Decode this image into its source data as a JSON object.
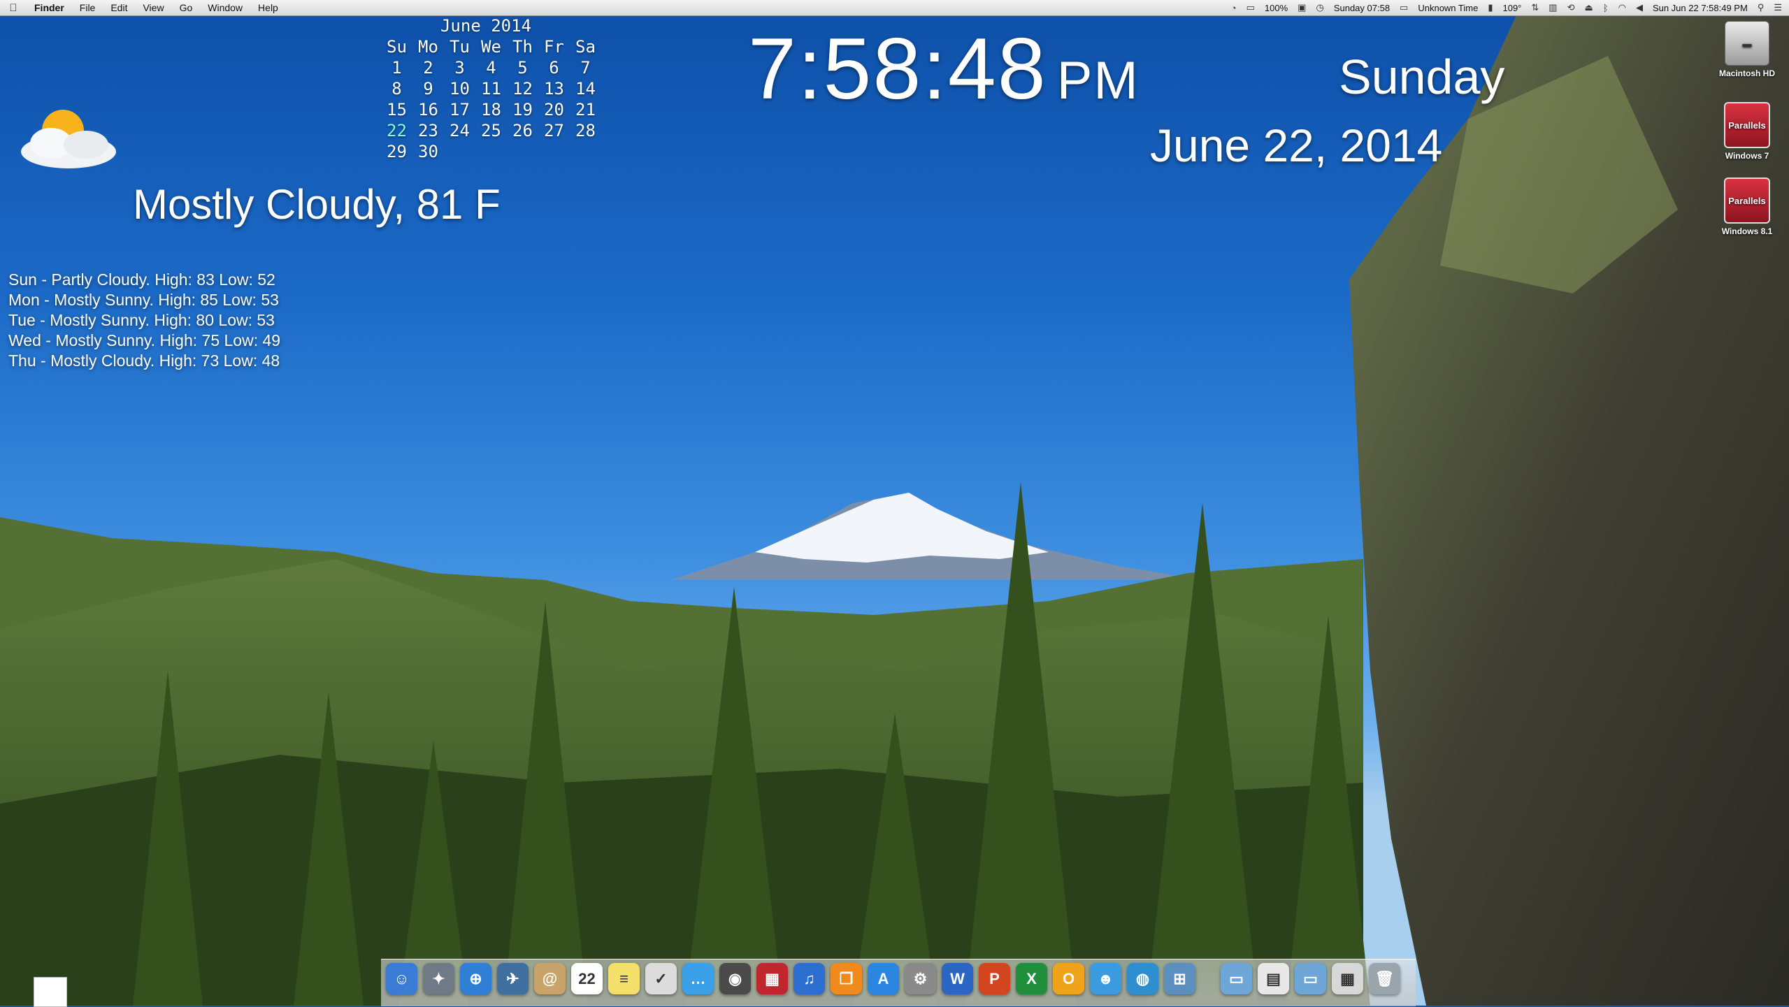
{
  "menubar": {
    "apple": "",
    "items": [
      "Finder",
      "File",
      "Edit",
      "View",
      "Go",
      "Window",
      "Help"
    ],
    "battery": "100%",
    "sunday_time": "Sunday 07:58",
    "unknown_time": "Unknown Time",
    "temp": "109°",
    "datetime": "Sun Jun 22  7:58:49 PM"
  },
  "calendar": {
    "title": "June 2014",
    "headers": [
      "Su",
      "Mo",
      "Tu",
      "We",
      "Th",
      "Fr",
      "Sa"
    ],
    "weeks": [
      [
        "1",
        "2",
        "3",
        "4",
        "5",
        "6",
        "7"
      ],
      [
        "8",
        "9",
        "10",
        "11",
        "12",
        "13",
        "14"
      ],
      [
        "15",
        "16",
        "17",
        "18",
        "19",
        "20",
        "21"
      ],
      [
        "22",
        "23",
        "24",
        "25",
        "26",
        "27",
        "28"
      ],
      [
        "29",
        "30",
        "",
        "",
        "",
        "",
        ""
      ]
    ],
    "today": "22"
  },
  "clock": {
    "time": "7:58:48",
    "ampm": "PM"
  },
  "day_name": "Sunday",
  "date_string": "June 22, 2014",
  "weather": {
    "icon": "partly-cloudy-icon",
    "condition": "Mostly Cloudy, 81 F",
    "forecast": [
      "Sun - Partly Cloudy. High: 83 Low: 52",
      "Mon - Mostly Sunny. High: 85 Low: 53",
      "Tue - Mostly Sunny. High: 80 Low: 53",
      "Wed - Mostly Sunny. High: 75 Low: 49",
      "Thu - Mostly Cloudy. High: 73 Low: 48"
    ]
  },
  "desktop_icons": [
    {
      "name": "hard-drive-icon",
      "label": "Macintosh HD"
    },
    {
      "name": "parallels-icon",
      "label": "Windows 7",
      "badge": "Parallels"
    },
    {
      "name": "parallels-icon",
      "label": "Windows 8.1",
      "badge": "Parallels"
    }
  ],
  "dock": {
    "items": [
      {
        "name": "finder-icon",
        "color": "#3a7bd5",
        "glyph": "☺"
      },
      {
        "name": "launchpad-icon",
        "color": "#707a86",
        "glyph": "✦"
      },
      {
        "name": "safari-icon",
        "color": "#2f7fd6",
        "glyph": "⊕"
      },
      {
        "name": "preview-icon",
        "color": "#3f6f9e",
        "glyph": "✈"
      },
      {
        "name": "contacts-icon",
        "color": "#c8a46a",
        "glyph": "@"
      },
      {
        "name": "calendar-icon",
        "color": "#ffffff",
        "glyph": "22"
      },
      {
        "name": "notes-icon",
        "color": "#f4e06a",
        "glyph": "≡"
      },
      {
        "name": "reminders-icon",
        "color": "#dcdcdc",
        "glyph": "✓"
      },
      {
        "name": "messages-icon",
        "color": "#3aa0e8",
        "glyph": "…"
      },
      {
        "name": "facetime-icon",
        "color": "#4a4a4a",
        "glyph": "◉"
      },
      {
        "name": "photo-booth-icon",
        "color": "#c0262d",
        "glyph": "▦"
      },
      {
        "name": "itunes-icon",
        "color": "#2c6fd0",
        "glyph": "♫"
      },
      {
        "name": "ibooks-icon",
        "color": "#f08a1c",
        "glyph": "❐"
      },
      {
        "name": "app-store-icon",
        "color": "#2a86e0",
        "glyph": "A"
      },
      {
        "name": "system-preferences-icon",
        "color": "#8a8a8a",
        "glyph": "⚙"
      },
      {
        "name": "word-icon",
        "color": "#2b66c4",
        "glyph": "W"
      },
      {
        "name": "powerpoint-icon",
        "color": "#d2451e",
        "glyph": "P"
      },
      {
        "name": "excel-icon",
        "color": "#1f8f3c",
        "glyph": "X"
      },
      {
        "name": "outlook-icon",
        "color": "#f0a21a",
        "glyph": "O"
      },
      {
        "name": "messenger-icon",
        "color": "#3b9be0",
        "glyph": "☻"
      },
      {
        "name": "network-icon",
        "color": "#2e8fd0",
        "glyph": "◍"
      },
      {
        "name": "windows-app-icon",
        "color": "#5a8fbf",
        "glyph": "⊞"
      },
      {
        "name": "applications-folder-icon",
        "color": "#6fa6d8",
        "glyph": "▭"
      },
      {
        "name": "document-icon",
        "color": "#e8e8e8",
        "glyph": "▤"
      },
      {
        "name": "downloads-folder-icon",
        "color": "#6fa6d8",
        "glyph": "▭"
      },
      {
        "name": "stack-icon",
        "color": "#d8d8d8",
        "glyph": "▦"
      },
      {
        "name": "trash-icon",
        "color": "#9aa4ad",
        "glyph": "🗑"
      }
    ]
  }
}
